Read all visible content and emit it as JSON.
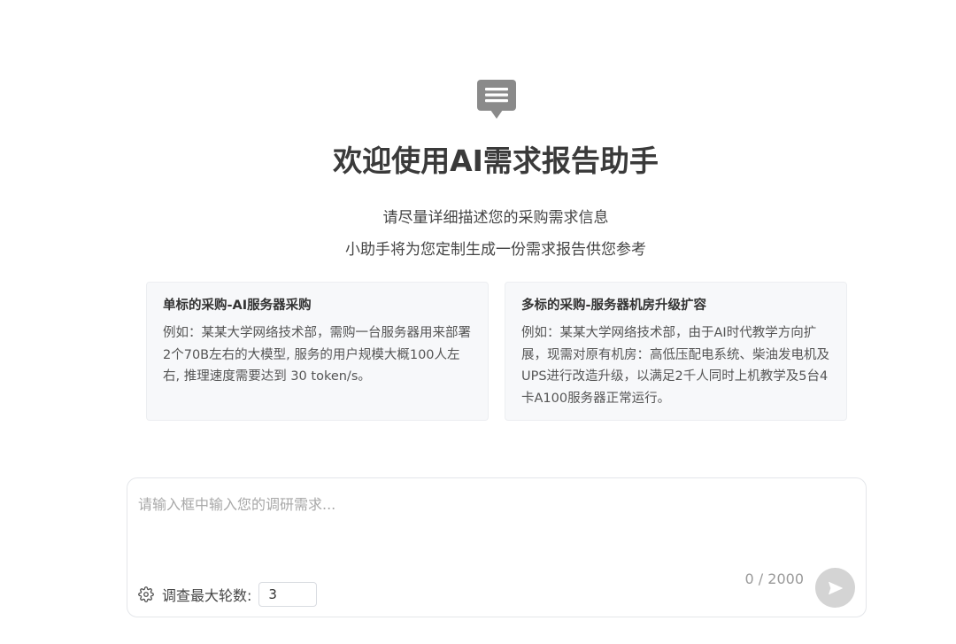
{
  "header": {
    "icon": "chat-message-icon",
    "title": "欢迎使用AI需求报告助手",
    "subtitle_line1": "请尽量详细描述您的采购需求信息",
    "subtitle_line2": "小助手将为您定制生成一份需求报告供您参考"
  },
  "examples": [
    {
      "title": "单标的采购-AI服务器采购",
      "body": "例如：某某大学网络技术部，需购一台服务器用来部署2个70B左右的大模型, 服务的用户规模大概100人左右, 推理速度需要达到 30 token/s。"
    },
    {
      "title": "多标的采购-服务器机房升级扩容",
      "body": "例如：某某大学网络技术部，由于AI时代教学方向扩展，现需对原有机房：高低压配电系统、柴油发电机及UPS进行改造升级，以满足2千人同时上机教学及5台4卡A100服务器正常运行。"
    }
  ],
  "input": {
    "placeholder": "请输入框中输入您的调研需求...",
    "value": "",
    "counter": "0 / 2000",
    "rounds_label": "调查最大轮数:",
    "rounds_value": "3",
    "settings_icon": "gear-icon",
    "send_icon": "send-icon"
  },
  "colors": {
    "icon_gray": "#8a8a8a",
    "send_button_bg": "#d4d4d4",
    "card_bg": "#f7f8fa"
  }
}
